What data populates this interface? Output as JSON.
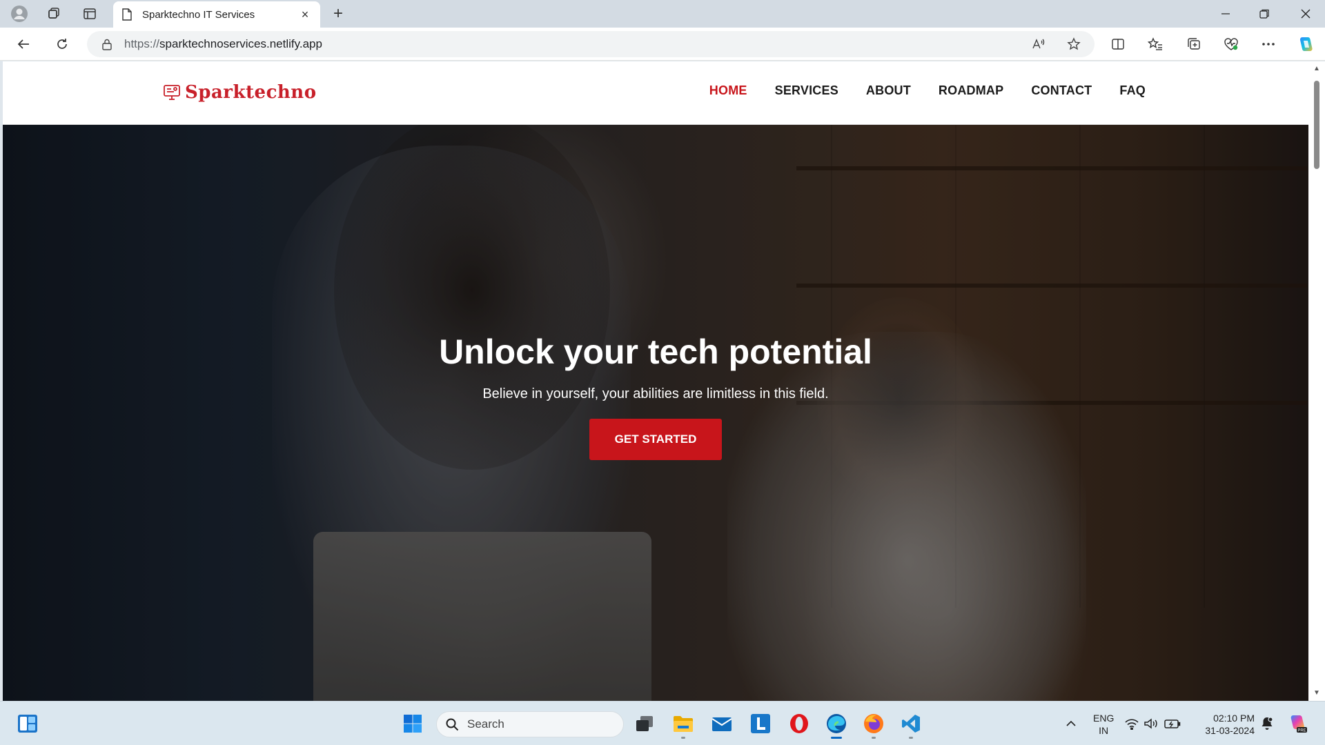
{
  "browser": {
    "tab_title": "Sparktechno IT Services",
    "tab_close": "×",
    "new_tab": "+",
    "url_scheme": "https://",
    "url_host": "sparktechnoservices.netlify.app"
  },
  "site": {
    "logo_text": "Sparktechno",
    "brand_color": "#c8151b",
    "nav": [
      {
        "label": "HOME",
        "active": true
      },
      {
        "label": "SERVICES",
        "active": false
      },
      {
        "label": "ABOUT",
        "active": false
      },
      {
        "label": "ROADMAP",
        "active": false
      },
      {
        "label": "CONTACT",
        "active": false
      },
      {
        "label": "FAQ",
        "active": false
      }
    ],
    "hero": {
      "title": "Unlock your tech potential",
      "subtitle": "Believe in yourself, your abilities are limitless in this field.",
      "cta_label": "GET STARTED"
    }
  },
  "taskbar": {
    "search_label": "Search",
    "lang_line1": "ENG",
    "lang_line2": "IN",
    "time": "02:10 PM",
    "date": "31-03-2024",
    "apps": [
      "start-icon",
      "search-icon",
      "task-view-icon",
      "file-explorer-icon",
      "mail-icon",
      "l-app-icon",
      "opera-icon",
      "edge-icon",
      "firefox-icon",
      "vscode-icon"
    ]
  }
}
